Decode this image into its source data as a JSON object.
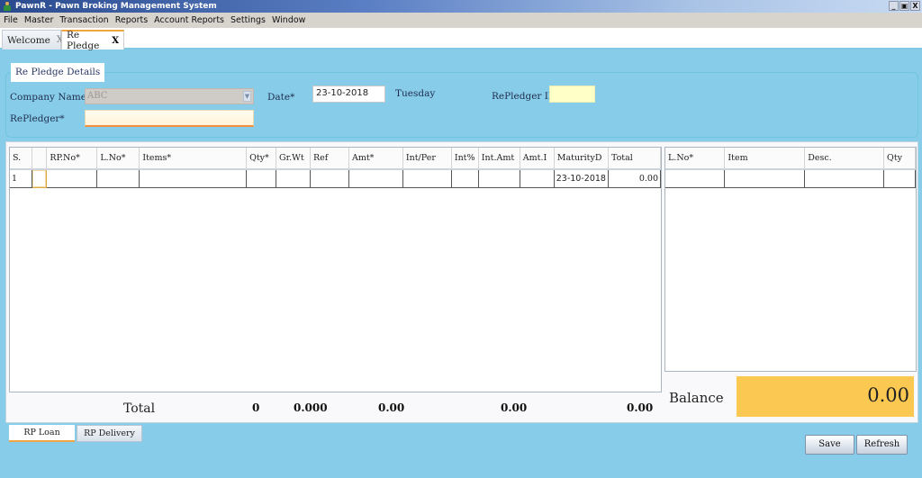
{
  "window": {
    "title": "PawnR - Pawn Broking Management System",
    "controls": {
      "minimize": "_",
      "restore": "▣",
      "close": "X"
    }
  },
  "menubar": {
    "items": [
      "File",
      "Master",
      "Transaction",
      "Reports",
      "Account Reports",
      "Settings",
      "Window"
    ]
  },
  "tabs": [
    {
      "label": "Welcome",
      "close": "X",
      "active": false
    },
    {
      "label": "Re Pledge",
      "close": "X",
      "active": true
    }
  ],
  "details": {
    "section_title": "Re Pledge Details",
    "company_name_label": "Company Name*",
    "company_name_value": "ABC",
    "date_label": "Date*",
    "date_value": "23-10-2018",
    "day_value": "Tuesday",
    "repledger_id_label": "RePledger ID",
    "repledger_id_value": "",
    "repledger_label": "RePledger*",
    "repledger_value": ""
  },
  "main_grid": {
    "columns": [
      "S.",
      "",
      "RP.No*",
      "L.No*",
      "Items*",
      "Qty*",
      "Gr.Wt",
      "Ref",
      "Amt*",
      "Int/Per",
      "Int%",
      "Int.Amt",
      "Amt.I",
      "MaturityD",
      "Total"
    ],
    "rows": [
      [
        "1",
        "",
        "",
        "",
        "",
        "",
        "",
        "",
        "",
        "",
        "",
        "",
        "",
        "23-10-2018",
        "0.00"
      ]
    ]
  },
  "side_grid": {
    "columns": [
      "L.No*",
      "Item",
      "Desc.",
      "Qty"
    ],
    "rows": [
      [
        "",
        "",
        "",
        ""
      ]
    ]
  },
  "totals": {
    "label": "Total",
    "qty": "0",
    "gr_wt": "0.000",
    "amt": "0.00",
    "int_amt": "0.00",
    "total": "0.00"
  },
  "balance": {
    "label": "Balance",
    "value": "0.00"
  },
  "bottom_tabs": [
    {
      "label": "RP Loan",
      "active": true
    },
    {
      "label": "RP Delivery",
      "active": false
    }
  ],
  "buttons": {
    "save": "Save",
    "refresh": "Refresh"
  },
  "colors": {
    "background": "#87cce8",
    "balance_box": "#fbc851",
    "active_tab_accent": "#f0a640",
    "repledger_id_field": "#ffffc8"
  }
}
